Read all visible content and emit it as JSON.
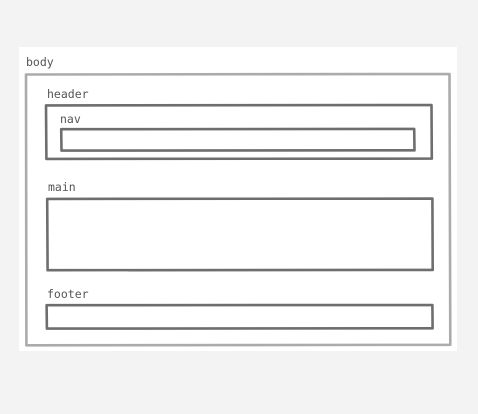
{
  "diagram": {
    "body_label": "body",
    "header_label": "header",
    "nav_label": "nav",
    "main_label": "main",
    "footer_label": "footer"
  }
}
